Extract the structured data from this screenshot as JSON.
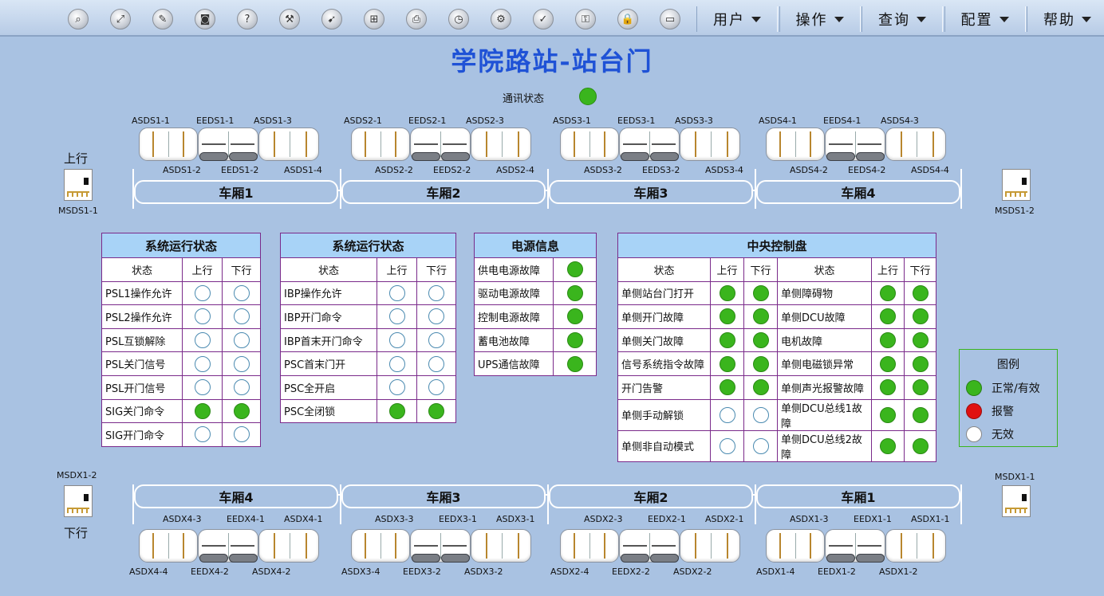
{
  "toolbar": {
    "icons": [
      "search-icon",
      "expand-icon",
      "edit-icon",
      "camera-icon",
      "help-icon",
      "tools-icon",
      "compass-icon",
      "network-icon",
      "printer-icon",
      "history-icon",
      "settings-icon",
      "check-icon",
      "key-icon",
      "lock-icon",
      "display-icon"
    ],
    "menus": [
      "用户",
      "操作",
      "查询",
      "配置",
      "帮助"
    ]
  },
  "title": "学院路站-站台门",
  "comm_status_label": "通讯状态",
  "direction": {
    "up": "上行",
    "down": "下行"
  },
  "msd": {
    "up_left": "MSDS1-1",
    "up_right": "MSDS1-2",
    "down_left": "MSDX1-2",
    "down_right": "MSDX1-1"
  },
  "up_cars": [
    {
      "label": "车厢1",
      "top": [
        "ASDS1-1",
        "EEDS1-1",
        "ASDS1-3"
      ],
      "bottom": [
        "ASDS1-2",
        "EEDS1-2",
        "ASDS1-4"
      ]
    },
    {
      "label": "车厢2",
      "top": [
        "ASDS2-1",
        "EEDS2-1",
        "ASDS2-3"
      ],
      "bottom": [
        "ASDS2-2",
        "EEDS2-2",
        "ASDS2-4"
      ]
    },
    {
      "label": "车厢3",
      "top": [
        "ASDS3-1",
        "EEDS3-1",
        "ASDS3-3"
      ],
      "bottom": [
        "ASDS3-2",
        "EEDS3-2",
        "ASDS3-4"
      ]
    },
    {
      "label": "车厢4",
      "top": [
        "ASDS4-1",
        "EEDS4-1",
        "ASDS4-3"
      ],
      "bottom": [
        "ASDS4-2",
        "EEDS4-2",
        "ASDS4-4"
      ]
    }
  ],
  "down_cars": [
    {
      "label": "车厢4",
      "top": [
        "ASDX4-3",
        "EEDX4-1",
        "ASDX4-1"
      ],
      "bottom": [
        "ASDX4-4",
        "EEDX4-2",
        "ASDX4-2"
      ]
    },
    {
      "label": "车厢3",
      "top": [
        "ASDX3-3",
        "EEDX3-1",
        "ASDX3-1"
      ],
      "bottom": [
        "ASDX3-4",
        "EEDX3-2",
        "ASDX3-2"
      ]
    },
    {
      "label": "车厢2",
      "top": [
        "ASDX2-3",
        "EEDX2-1",
        "ASDX2-1"
      ],
      "bottom": [
        "ASDX2-4",
        "EEDX2-2",
        "ASDX2-2"
      ]
    },
    {
      "label": "车厢1",
      "top": [
        "ASDX1-3",
        "EEDX1-1",
        "ASDX1-1"
      ],
      "bottom": [
        "ASDX1-4",
        "EEDX1-2",
        "ASDX1-2"
      ]
    }
  ],
  "panel1": {
    "title": "系统运行状态",
    "headers": [
      "状态",
      "上行",
      "下行"
    ],
    "rows": [
      {
        "label": "PSL1操作允许",
        "up": false,
        "down": false
      },
      {
        "label": "PSL2操作允许",
        "up": false,
        "down": false
      },
      {
        "label": "PSL互锁解除",
        "up": false,
        "down": false
      },
      {
        "label": "PSL关门信号",
        "up": false,
        "down": false
      },
      {
        "label": "PSL开门信号",
        "up": false,
        "down": false
      },
      {
        "label": "SIG关门命令",
        "up": true,
        "down": true
      },
      {
        "label": "SIG开门命令",
        "up": false,
        "down": false
      }
    ]
  },
  "panel2": {
    "title": "系统运行状态",
    "headers": [
      "状态",
      "上行",
      "下行"
    ],
    "rows": [
      {
        "label": "IBP操作允许",
        "up": false,
        "down": false
      },
      {
        "label": "IBP开门命令",
        "up": false,
        "down": false
      },
      {
        "label": "IBP首末开门命令",
        "up": false,
        "down": false
      },
      {
        "label": "PSC首末门开",
        "up": false,
        "down": false
      },
      {
        "label": "PSC全开启",
        "up": false,
        "down": false
      },
      {
        "label": "PSC全闭锁",
        "up": true,
        "down": true
      }
    ]
  },
  "panel3": {
    "title": "电源信息",
    "rows": [
      {
        "label": "供电电源故障",
        "on": true
      },
      {
        "label": "驱动电源故障",
        "on": true
      },
      {
        "label": "控制电源故障",
        "on": true
      },
      {
        "label": "蓄电池故障",
        "on": true
      },
      {
        "label": "UPS通信故障",
        "on": true
      }
    ]
  },
  "panel4": {
    "title": "中央控制盘",
    "headers": [
      "状态",
      "上行",
      "下行",
      "状态",
      "上行",
      "下行"
    ],
    "rows": [
      {
        "l1": "单侧站台门打开",
        "u1": true,
        "d1": true,
        "l2": "单侧障碍物",
        "u2": true,
        "d2": true
      },
      {
        "l1": "单侧开门故障",
        "u1": true,
        "d1": true,
        "l2": "单侧DCU故障",
        "u2": true,
        "d2": true
      },
      {
        "l1": "单侧关门故障",
        "u1": true,
        "d1": true,
        "l2": "电机故障",
        "u2": true,
        "d2": true
      },
      {
        "l1": "信号系统指令故障",
        "u1": true,
        "d1": true,
        "l2": "单侧电磁锁异常",
        "u2": true,
        "d2": true
      },
      {
        "l1": "开门告警",
        "u1": true,
        "d1": true,
        "l2": "单侧声光报警故障",
        "u2": true,
        "d2": true
      },
      {
        "l1": "单侧手动解锁",
        "u1": false,
        "d1": false,
        "l2": "单侧DCU总线1故障",
        "u2": true,
        "d2": true
      },
      {
        "l1": "单侧非自动模式",
        "u1": false,
        "d1": false,
        "l2": "单侧DCU总线2故障",
        "u2": true,
        "d2": true
      }
    ]
  },
  "legend": {
    "title": "图例",
    "items": [
      {
        "label": "正常/有效",
        "color": "#3ab51d"
      },
      {
        "label": "报警",
        "color": "#e01010"
      },
      {
        "label": "无效",
        "color": "#ffffff"
      }
    ]
  },
  "colors": {
    "on": "#3ab51d",
    "off": "#ffffff",
    "alarm": "#e01010",
    "title": "#1f52d6"
  }
}
